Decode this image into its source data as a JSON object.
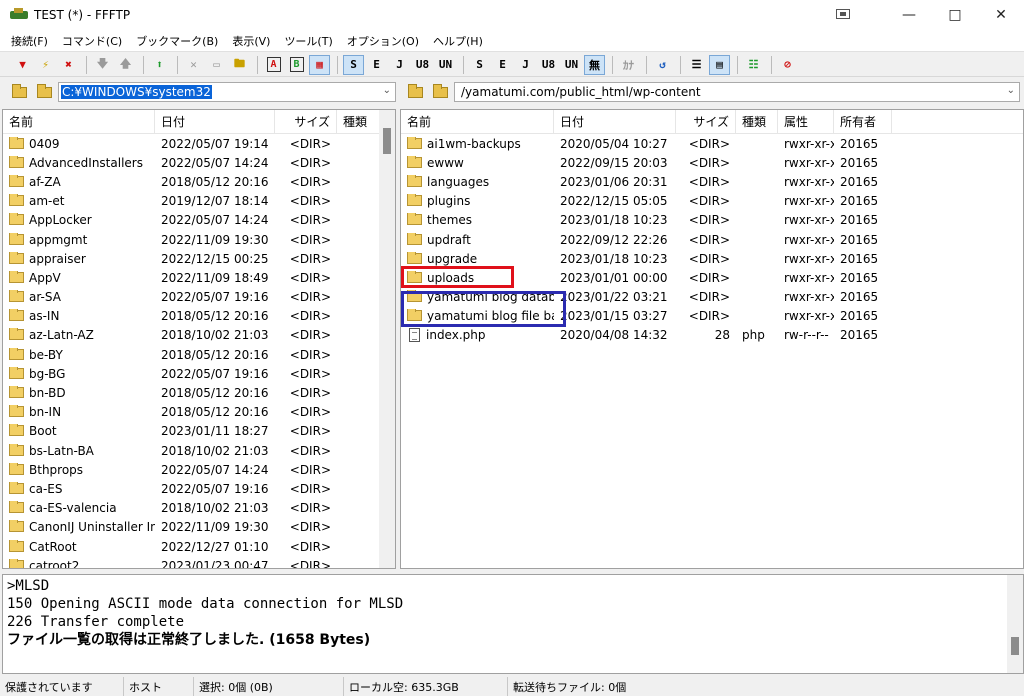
{
  "window": {
    "title": "TEST (*) - FFFTP"
  },
  "menu": [
    "接続(F)",
    "コマンド(C)",
    "ブックマーク(B)",
    "表示(V)",
    "ツール(T)",
    "オプション(O)",
    "ヘルプ(H)"
  ],
  "toolbar": {
    "tb_s": "S",
    "tb_e": "E",
    "tb_j": "J",
    "tb_u8": "U8",
    "tb_u8n": "UN",
    "tb_mu": "無",
    "tb_ka": "ｶﾅ",
    "tb_a": "A",
    "tb_b": "B"
  },
  "local": {
    "path": "C:¥WINDOWS¥system32",
    "headers": [
      "名前",
      "日付",
      "サイズ",
      "種類"
    ],
    "rows": [
      {
        "name": "0409",
        "date": "2022/05/07 19:14",
        "size": "<DIR>"
      },
      {
        "name": "AdvancedInstallers",
        "date": "2022/05/07 14:24",
        "size": "<DIR>"
      },
      {
        "name": "af-ZA",
        "date": "2018/05/12 20:16",
        "size": "<DIR>"
      },
      {
        "name": "am-et",
        "date": "2019/12/07 18:14",
        "size": "<DIR>"
      },
      {
        "name": "AppLocker",
        "date": "2022/05/07 14:24",
        "size": "<DIR>"
      },
      {
        "name": "appmgmt",
        "date": "2022/11/09 19:30",
        "size": "<DIR>"
      },
      {
        "name": "appraiser",
        "date": "2022/12/15 00:25",
        "size": "<DIR>"
      },
      {
        "name": "AppV",
        "date": "2022/11/09 18:49",
        "size": "<DIR>"
      },
      {
        "name": "ar-SA",
        "date": "2022/05/07 19:16",
        "size": "<DIR>"
      },
      {
        "name": "as-IN",
        "date": "2018/05/12 20:16",
        "size": "<DIR>"
      },
      {
        "name": "az-Latn-AZ",
        "date": "2018/10/02 21:03",
        "size": "<DIR>"
      },
      {
        "name": "be-BY",
        "date": "2018/05/12 20:16",
        "size": "<DIR>"
      },
      {
        "name": "bg-BG",
        "date": "2022/05/07 19:16",
        "size": "<DIR>"
      },
      {
        "name": "bn-BD",
        "date": "2018/05/12 20:16",
        "size": "<DIR>"
      },
      {
        "name": "bn-IN",
        "date": "2018/05/12 20:16",
        "size": "<DIR>"
      },
      {
        "name": "Boot",
        "date": "2023/01/11 18:27",
        "size": "<DIR>"
      },
      {
        "name": "bs-Latn-BA",
        "date": "2018/10/02 21:03",
        "size": "<DIR>"
      },
      {
        "name": "Bthprops",
        "date": "2022/05/07 14:24",
        "size": "<DIR>"
      },
      {
        "name": "ca-ES",
        "date": "2022/05/07 19:16",
        "size": "<DIR>"
      },
      {
        "name": "ca-ES-valencia",
        "date": "2018/10/02 21:03",
        "size": "<DIR>"
      },
      {
        "name": "CanonIJ Uninstaller Inf...",
        "date": "2022/11/09 19:30",
        "size": "<DIR>"
      },
      {
        "name": "CatRoot",
        "date": "2022/12/27 01:10",
        "size": "<DIR>"
      },
      {
        "name": "catroot2",
        "date": "2023/01/23 00:47",
        "size": "<DIR>"
      }
    ]
  },
  "remote": {
    "path": "/yamatumi.com/public_html/wp-content",
    "headers": [
      "名前",
      "日付",
      "サイズ",
      "種類",
      "属性",
      "所有者"
    ],
    "rows": [
      {
        "name": "ai1wm-backups",
        "date": "2020/05/04 10:27",
        "size": "<DIR>",
        "type": "",
        "attr": "rwxr-xr-x",
        "owner": "20165",
        "icon": "folder"
      },
      {
        "name": "ewww",
        "date": "2022/09/15 20:03",
        "size": "<DIR>",
        "type": "",
        "attr": "rwxr-xr-x",
        "owner": "20165",
        "icon": "folder"
      },
      {
        "name": "languages",
        "date": "2023/01/06 20:31",
        "size": "<DIR>",
        "type": "",
        "attr": "rwxr-xr-x",
        "owner": "20165",
        "icon": "folder"
      },
      {
        "name": "plugins",
        "date": "2022/12/15 05:05",
        "size": "<DIR>",
        "type": "",
        "attr": "rwxr-xr-x",
        "owner": "20165",
        "icon": "folder"
      },
      {
        "name": "themes",
        "date": "2023/01/18 10:23",
        "size": "<DIR>",
        "type": "",
        "attr": "rwxr-xr-x",
        "owner": "20165",
        "icon": "folder"
      },
      {
        "name": "updraft",
        "date": "2022/09/12 22:26",
        "size": "<DIR>",
        "type": "",
        "attr": "rwxr-xr-x",
        "owner": "20165",
        "icon": "folder"
      },
      {
        "name": "upgrade",
        "date": "2023/01/18 10:23",
        "size": "<DIR>",
        "type": "",
        "attr": "rwxr-xr-x",
        "owner": "20165",
        "icon": "folder"
      },
      {
        "name": "uploads",
        "date": "2023/01/01 00:00",
        "size": "<DIR>",
        "type": "",
        "attr": "rwxr-xr-x",
        "owner": "20165",
        "icon": "folder"
      },
      {
        "name": "yamatumi blog databa...",
        "date": "2023/01/22 03:21",
        "size": "<DIR>",
        "type": "",
        "attr": "rwxr-xr-x",
        "owner": "20165",
        "icon": "folder"
      },
      {
        "name": "yamatumi blog file bac...",
        "date": "2023/01/15 03:27",
        "size": "<DIR>",
        "type": "",
        "attr": "rwxr-xr-x",
        "owner": "20165",
        "icon": "folder"
      },
      {
        "name": "index.php",
        "date": "2020/04/08 14:32",
        "size": "28",
        "type": "php",
        "attr": "rw-r--r--",
        "owner": "20165",
        "icon": "file"
      }
    ]
  },
  "log": {
    "line1": ">MLSD",
    "line2": "150 Opening ASCII mode data connection for MLSD",
    "line3": "226 Transfer complete",
    "line4": "ファイル一覧の取得は正常終了しました. (1658 Bytes)"
  },
  "status": {
    "protect": "保護されています",
    "host": "ホスト",
    "selection": "選択: 0個 (0B)",
    "local_free": "ローカル空: 635.3GB",
    "queue": "転送待ちファイル: 0個"
  }
}
